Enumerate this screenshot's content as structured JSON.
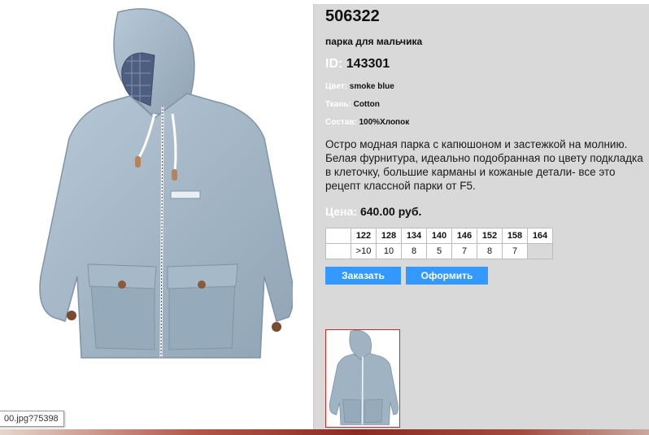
{
  "product": {
    "sku": "506322",
    "name": "парка для мальчика",
    "id_label": "ID:",
    "id_value": "143301",
    "color_label": "Цвет:",
    "color_value": "smoke blue",
    "fabric_label": "Ткань:",
    "fabric_value": "Cotton",
    "composition_label": "Состав:",
    "composition_value": "100%Хлопок",
    "description": "Остро модная парка с капюшоном и застежкой на молнию. Белая фурнитура, идеально подобранная по цвету подкладка в клеточку, большие карманы и кожаные детали- все это рецепт классной парки от F5.",
    "price_label": "Цена:",
    "price_value": "640.00 руб."
  },
  "sizes": {
    "headers": [
      "122",
      "128",
      "134",
      "140",
      "146",
      "152",
      "158",
      "164"
    ],
    "quantities": [
      ">10",
      "10",
      "8",
      "5",
      "7",
      "8",
      "7",
      ""
    ]
  },
  "buttons": {
    "order": "Заказать",
    "checkout": "Оформить"
  },
  "tooltip": "00.jpg?75398",
  "colors": {
    "jacket": "#9fb3c3",
    "panel": "#d9d9d9",
    "button": "#3399ff",
    "thumb_border": "#c62828"
  },
  "images": {
    "main": "jacket-image",
    "thumbnail": "jacket-thumbnail"
  }
}
